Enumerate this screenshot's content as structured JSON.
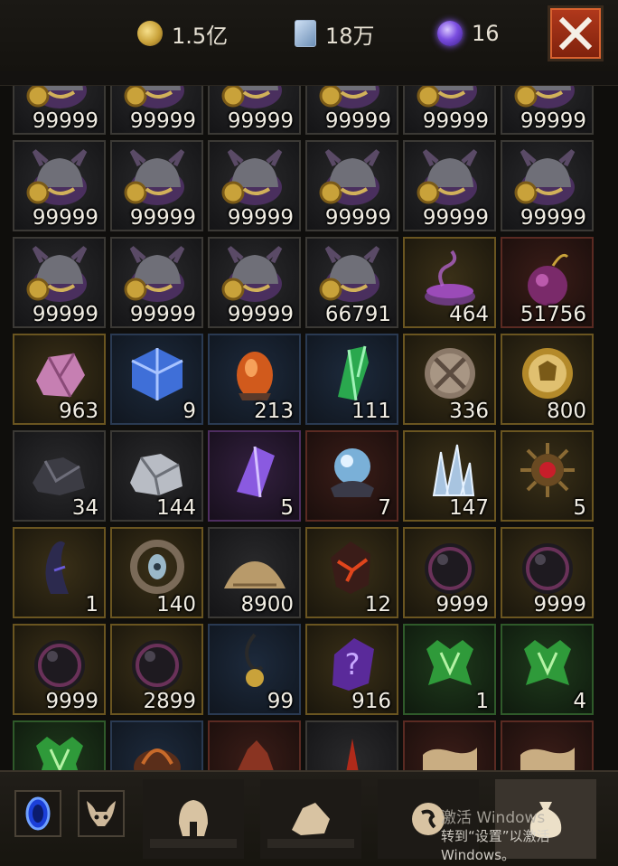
{
  "currency": {
    "gold": {
      "icon": "gold-coin-icon",
      "value": "1.5亿"
    },
    "cards": {
      "icon": "card-icon",
      "value": "18万"
    },
    "orbs": {
      "icon": "purple-orb-icon",
      "value": "16"
    }
  },
  "close_icon": "close-icon",
  "inventory": [
    {
      "icon": "beast-helm-icon",
      "qty": "99999",
      "rarity": "grey"
    },
    {
      "icon": "beast-helm-icon",
      "qty": "99999",
      "rarity": "grey"
    },
    {
      "icon": "beast-helm-icon",
      "qty": "99999",
      "rarity": "grey"
    },
    {
      "icon": "beast-helm-icon",
      "qty": "99999",
      "rarity": "grey"
    },
    {
      "icon": "beast-helm-icon",
      "qty": "99999",
      "rarity": "grey"
    },
    {
      "icon": "beast-helm-icon",
      "qty": "99999",
      "rarity": "grey"
    },
    {
      "icon": "beast-helm-icon",
      "qty": "99999",
      "rarity": "grey"
    },
    {
      "icon": "beast-helm-icon",
      "qty": "99999",
      "rarity": "grey"
    },
    {
      "icon": "beast-helm-icon",
      "qty": "99999",
      "rarity": "grey"
    },
    {
      "icon": "beast-helm-icon",
      "qty": "99999",
      "rarity": "grey"
    },
    {
      "icon": "beast-helm-icon",
      "qty": "99999",
      "rarity": "grey"
    },
    {
      "icon": "beast-helm-icon",
      "qty": "99999",
      "rarity": "grey"
    },
    {
      "icon": "beast-helm-icon",
      "qty": "99999",
      "rarity": "grey"
    },
    {
      "icon": "beast-helm-icon",
      "qty": "99999",
      "rarity": "grey"
    },
    {
      "icon": "beast-helm-icon",
      "qty": "99999",
      "rarity": "grey"
    },
    {
      "icon": "beast-helm-icon",
      "qty": "66791",
      "rarity": "grey"
    },
    {
      "icon": "purple-incense-bowl-icon",
      "qty": "464",
      "rarity": "gold"
    },
    {
      "icon": "purple-potion-icon",
      "qty": "51756",
      "rarity": "red"
    },
    {
      "icon": "pink-ore-icon",
      "qty": "963",
      "rarity": "gold"
    },
    {
      "icon": "blue-cube-icon",
      "qty": "9",
      "rarity": "blue"
    },
    {
      "icon": "fire-egg-icon",
      "qty": "213",
      "rarity": "blue"
    },
    {
      "icon": "green-crystal-icon",
      "qty": "111",
      "rarity": "blue"
    },
    {
      "icon": "crossed-swords-coin-icon",
      "qty": "336",
      "rarity": "gold"
    },
    {
      "icon": "gold-medallion-icon",
      "qty": "800",
      "rarity": "gold"
    },
    {
      "icon": "dark-ore-icon",
      "qty": "34",
      "rarity": "grey"
    },
    {
      "icon": "silver-ore-icon",
      "qty": "144",
      "rarity": "grey"
    },
    {
      "icon": "purple-crystal-icon",
      "qty": "5",
      "rarity": "purple"
    },
    {
      "icon": "mystic-orb-icon",
      "qty": "7",
      "rarity": "red"
    },
    {
      "icon": "ice-shards-icon",
      "qty": "147",
      "rarity": "gold"
    },
    {
      "icon": "ruby-sun-icon",
      "qty": "5",
      "rarity": "gold"
    },
    {
      "icon": "dark-horn-icon",
      "qty": "1",
      "rarity": "gold"
    },
    {
      "icon": "eye-ring-icon",
      "qty": "140",
      "rarity": "gold"
    },
    {
      "icon": "sand-pile-icon",
      "qty": "8900",
      "rarity": "grey"
    },
    {
      "icon": "lava-stone-icon",
      "qty": "12",
      "rarity": "gold"
    },
    {
      "icon": "dark-sphere-icon",
      "qty": "9999",
      "rarity": "gold"
    },
    {
      "icon": "dark-sphere-icon",
      "qty": "9999",
      "rarity": "gold"
    },
    {
      "icon": "dark-sphere-icon",
      "qty": "9999",
      "rarity": "gold"
    },
    {
      "icon": "dark-sphere-icon",
      "qty": "2899",
      "rarity": "gold"
    },
    {
      "icon": "hook-pendant-icon",
      "qty": "99",
      "rarity": "blue"
    },
    {
      "icon": "question-stone-icon",
      "qty": "916",
      "rarity": "gold"
    },
    {
      "icon": "green-sigil-icon",
      "qty": "1",
      "rarity": "green"
    },
    {
      "icon": "green-sigil-icon",
      "qty": "4",
      "rarity": "green"
    },
    {
      "icon": "green-sigil-icon",
      "qty": "",
      "rarity": "green"
    },
    {
      "icon": "flame-relic-icon",
      "qty": "",
      "rarity": "blue"
    },
    {
      "icon": "red-rock-icon",
      "qty": "",
      "rarity": "red"
    },
    {
      "icon": "red-spike-icon",
      "qty": "",
      "rarity": "grey"
    },
    {
      "icon": "scroll-icon",
      "qty": "",
      "rarity": "red"
    },
    {
      "icon": "scroll-icon",
      "qty": "",
      "rarity": "red"
    }
  ],
  "bottom": {
    "left_buttons": [
      {
        "icon": "blue-portal-icon"
      },
      {
        "icon": "demon-mask-icon"
      }
    ],
    "tabs": [
      {
        "icon": "helmet-tab-icon",
        "active": false
      },
      {
        "icon": "stone-tab-icon",
        "active": false
      },
      {
        "icon": "rune-tab-icon",
        "active": false
      },
      {
        "icon": "bag-tab-icon",
        "active": true
      }
    ]
  },
  "watermark": {
    "line1": "激活 Windows",
    "line2": "转到“设置”以激活 Windows。"
  }
}
